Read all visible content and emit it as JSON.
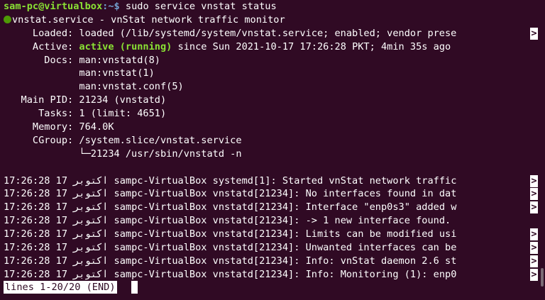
{
  "prompt": {
    "user_host": "sam-pc@virtualbox",
    "path": ":~$",
    "command": " sudo service vnstat status"
  },
  "service": {
    "header": "vnstat.service - vnStat network traffic monitor",
    "loaded": "     Loaded: loaded (/lib/systemd/system/vnstat.service; enabled; vendor prese",
    "active_label": "     Active: ",
    "active_state": "active (running)",
    "active_rest": " since Sun 2021-10-17 17:26:28 PKT; 4min 35s ago",
    "docs": [
      "       Docs: man:vnstatd(8)",
      "             man:vnstat(1)",
      "             man:vnstat.conf(5)"
    ],
    "main_pid": "   Main PID: 21234 (vnstatd)",
    "tasks": "      Tasks: 1 (limit: 4651)",
    "memory": "     Memory: 764.0K",
    "cgroup": "     CGroup: /system.slice/vnstat.service",
    "cgroup_child": "             └─21234 /usr/sbin/vnstatd -n"
  },
  "log": {
    "lines": [
      "17:26:28 17 اکتوبر sampc-VirtualBox systemd[1]: Started vnStat network traffic",
      "17:26:28 17 اکتوبر sampc-VirtualBox vnstatd[21234]: No interfaces found in dat",
      "17:26:28 17 اکتوبر sampc-VirtualBox vnstatd[21234]: Interface \"enp0s3\" added w",
      "17:26:28 17 اکتوبر sampc-VirtualBox vnstatd[21234]: -> 1 new interface found.",
      "17:26:28 17 اکتوبر sampc-VirtualBox vnstatd[21234]: Limits can be modified usi",
      "17:26:28 17 اکتوبر sampc-VirtualBox vnstatd[21234]: Unwanted interfaces can be",
      "17:26:28 17 اکتوبر sampc-VirtualBox vnstatd[21234]: Info: vnStat daemon 2.6 st",
      "17:26:28 17 اکتوبر sampc-VirtualBox vnstatd[21234]: Info: Monitoring (1): enp0"
    ],
    "truncated": [
      true,
      true,
      true,
      false,
      true,
      true,
      true,
      true
    ]
  },
  "pager": {
    "status": "lines 1-20/20 (END)"
  },
  "truncation_marker": ">",
  "colors": {
    "background": "#300a24",
    "prompt_user": "#8ae234",
    "prompt_path": "#729fcf",
    "active_green": "#8ae234",
    "status_dot": "#4e9a06"
  }
}
